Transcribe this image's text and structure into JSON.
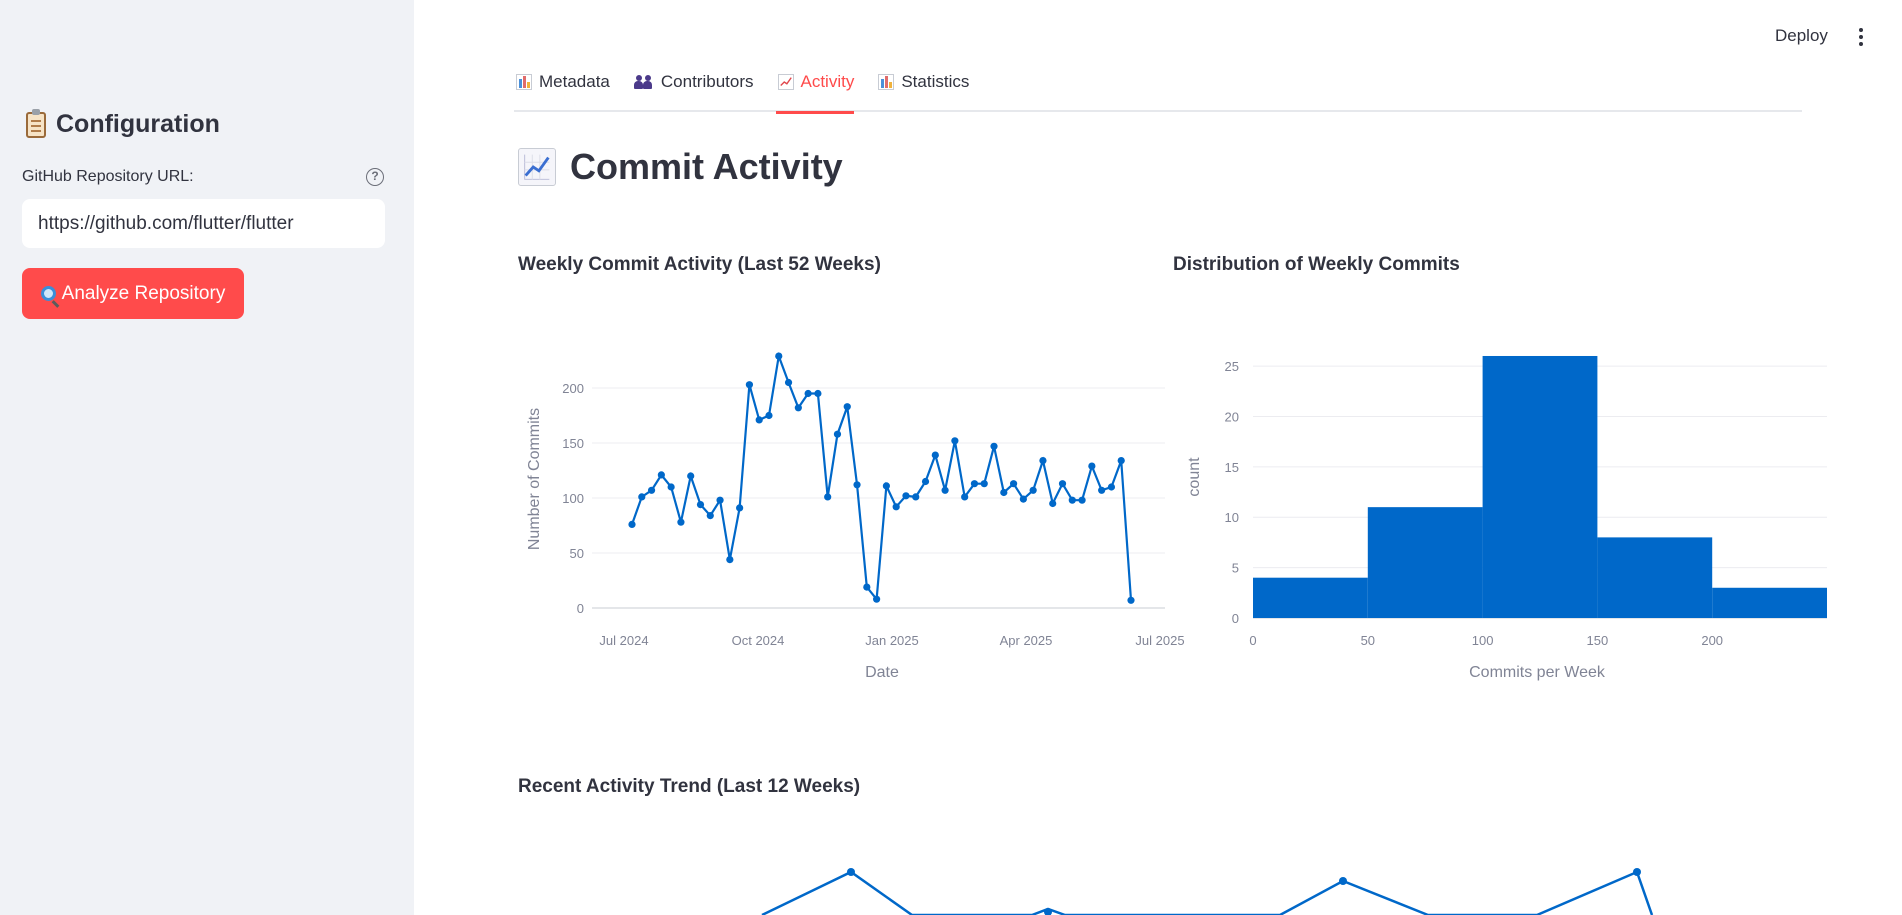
{
  "sidebar": {
    "title": "Configuration",
    "title_icon": "clipboard-icon",
    "url_label": "GitHub Repository URL:",
    "url_value": "https://github.com/flutter/flutter",
    "analyze_label": "Analyze Repository",
    "analyze_icon": "magnifier-icon"
  },
  "header": {
    "deploy_label": "Deploy",
    "menu_icon": "kebab-menu-icon"
  },
  "tabs": [
    {
      "label": "Metadata",
      "icon": "bar-chart-icon",
      "active": false
    },
    {
      "label": "Contributors",
      "icon": "people-icon",
      "active": false
    },
    {
      "label": "Activity",
      "icon": "trend-chart-icon",
      "active": true
    },
    {
      "label": "Statistics",
      "icon": "bar-chart-icon",
      "active": false
    }
  ],
  "main": {
    "title": "Commit Activity",
    "title_icon": "trend-chart-icon"
  },
  "colors": {
    "accent": "#ff4b4b",
    "series": "#0068c9",
    "sidebar_bg": "#f0f2f6"
  },
  "chart_data": [
    {
      "type": "line",
      "title": "Weekly Commit Activity (Last 52 Weeks)",
      "xlabel": "Date",
      "ylabel": "Number of Commits",
      "x_ticks": [
        "Jul 2024",
        "Oct 2024",
        "Jan 2025",
        "Apr 2025",
        "Jul 2025"
      ],
      "y_ticks": [
        0,
        50,
        100,
        150,
        200
      ],
      "ylim": [
        0,
        230
      ],
      "grid": true,
      "markers": true,
      "values": [
        76,
        101,
        107,
        121,
        110,
        78,
        120,
        94,
        84,
        98,
        44,
        91,
        203,
        171,
        175,
        229,
        205,
        182,
        195,
        195,
        101,
        158,
        183,
        112,
        19,
        8,
        111,
        92,
        102,
        101,
        115,
        139,
        107,
        152,
        101,
        113,
        113,
        147,
        105,
        113,
        99,
        107,
        134,
        95,
        113,
        98,
        98,
        129,
        107,
        110,
        134,
        7
      ]
    },
    {
      "type": "bar",
      "title": "Distribution of Weekly Commits",
      "xlabel": "Commits per Week",
      "ylabel": "count",
      "x_ticks": [
        0,
        50,
        100,
        150,
        200
      ],
      "y_ticks": [
        0,
        5,
        10,
        15,
        20,
        25
      ],
      "bins": [
        {
          "start": 0,
          "end": 50,
          "count": 4
        },
        {
          "start": 50,
          "end": 100,
          "count": 11
        },
        {
          "start": 100,
          "end": 150,
          "count": 26
        },
        {
          "start": 150,
          "end": 200,
          "count": 8
        },
        {
          "start": 200,
          "end": 250,
          "count": 3
        }
      ]
    },
    {
      "type": "line",
      "title": "Recent Activity Trend (Last 12 Weeks)"
    }
  ]
}
